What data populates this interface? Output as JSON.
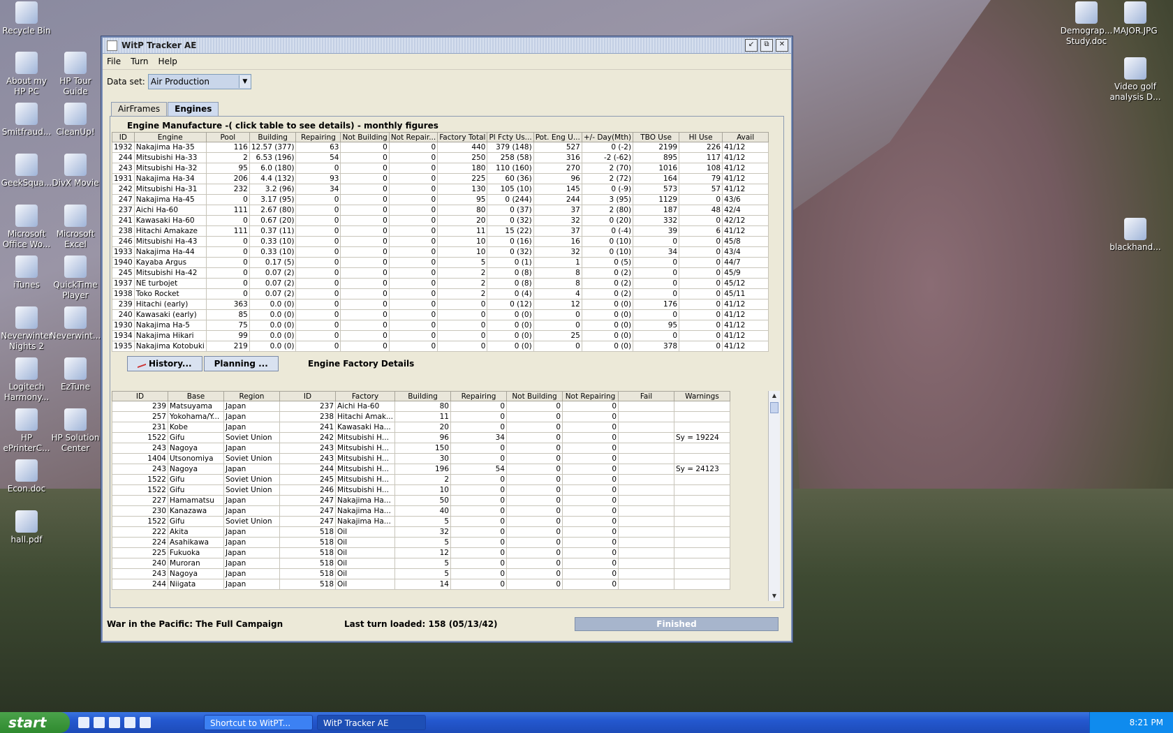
{
  "desktop": {
    "icons_left": [
      {
        "label": "Recycle Bin",
        "icon": "recycle-bin-icon"
      },
      {
        "label": "About my HP PC",
        "icon": "hp-info-icon"
      },
      {
        "label": "HP Tour Guide",
        "icon": "hp-tour-icon"
      },
      {
        "label": "Smitfraud...",
        "icon": "hazard-icon"
      },
      {
        "label": "CleanUp!",
        "icon": "cleanup-icon"
      },
      {
        "label": "GeekSqua...",
        "icon": "ie-icon"
      },
      {
        "label": "DivX Movie",
        "icon": "divx-icon"
      },
      {
        "label": "Microsoft Office Wo...",
        "icon": "word-icon"
      },
      {
        "label": "Microsoft Excel",
        "icon": "excel-icon"
      },
      {
        "label": "iTunes",
        "icon": "itunes-icon"
      },
      {
        "label": "QuickTime Player",
        "icon": "quicktime-icon"
      },
      {
        "label": "Neverwinter Nights 2",
        "icon": "nwn2-icon"
      },
      {
        "label": "Neverwint...",
        "icon": "nwn-icon"
      },
      {
        "label": "Logitech Harmony...",
        "icon": "logitech-icon"
      },
      {
        "label": "EzTune",
        "icon": "eztune-icon"
      },
      {
        "label": "HP ePrinterC...",
        "icon": "hp-printer-icon"
      },
      {
        "label": "HP Solution Center",
        "icon": "hp-solution-icon"
      },
      {
        "label": "Econ.doc",
        "icon": "word-doc-icon"
      },
      {
        "label": "hall.pdf",
        "icon": "pdf-icon"
      }
    ],
    "icons_right": [
      {
        "label": "Demograp... Study.doc",
        "icon": "word-doc-icon"
      },
      {
        "label": "MAJOR.JPG",
        "icon": "image-icon"
      },
      {
        "label": "Video golf analysis D...",
        "icon": "video-icon"
      },
      {
        "label": "blackhand...",
        "icon": "pdf-icon"
      }
    ]
  },
  "window": {
    "title": "WitP Tracker AE",
    "menu": [
      "File",
      "Turn",
      "Help"
    ],
    "dataset_label": "Data set:",
    "dataset_value": "Air Production",
    "tabs": [
      "AirFrames",
      "Engines"
    ],
    "caption": "Engine Manufacture -( click table to see details) - monthly figures",
    "engine_headers": [
      "ID",
      "Engine",
      "Pool",
      "Building",
      "Repairing",
      "Not Building",
      "Not Repair...",
      "Factory Total",
      "Pl Fcty Us...",
      "Pot. Eng U...",
      "+/- Day(Mth)",
      "TBO Use",
      "HI Use",
      "Avail"
    ],
    "engine_rows": [
      [
        "1932",
        "Nakajima Ha-35",
        "116",
        "12.57 (377)",
        "63",
        "0",
        "0",
        "440",
        "379 (148)",
        "527",
        "0 (-2)",
        "2199",
        "226",
        "41/12"
      ],
      [
        "244",
        "Mitsubishi Ha-33",
        "2",
        "6.53 (196)",
        "54",
        "0",
        "0",
        "250",
        "258 (58)",
        "316",
        "-2 (-62)",
        "895",
        "117",
        "41/12"
      ],
      [
        "243",
        "Mitsubishi Ha-32",
        "95",
        "6.0 (180)",
        "0",
        "0",
        "0",
        "180",
        "110 (160)",
        "270",
        "2 (70)",
        "1016",
        "108",
        "41/12"
      ],
      [
        "1931",
        "Nakajima Ha-34",
        "206",
        "4.4 (132)",
        "93",
        "0",
        "0",
        "225",
        "60 (36)",
        "96",
        "2 (72)",
        "164",
        "79",
        "41/12"
      ],
      [
        "242",
        "Mitsubishi Ha-31",
        "232",
        "3.2 (96)",
        "34",
        "0",
        "0",
        "130",
        "105 (10)",
        "145",
        "0 (-9)",
        "573",
        "57",
        "41/12"
      ],
      [
        "247",
        "Nakajima Ha-45",
        "0",
        "3.17 (95)",
        "0",
        "0",
        "0",
        "95",
        "0 (244)",
        "244",
        "3 (95)",
        "1129",
        "0",
        "43/6"
      ],
      [
        "237",
        "Aichi Ha-60",
        "111",
        "2.67 (80)",
        "0",
        "0",
        "0",
        "80",
        "0 (37)",
        "37",
        "2 (80)",
        "187",
        "48",
        "42/4"
      ],
      [
        "241",
        "Kawasaki Ha-60",
        "0",
        "0.67 (20)",
        "0",
        "0",
        "0",
        "20",
        "0 (32)",
        "32",
        "0 (20)",
        "332",
        "0",
        "42/12"
      ],
      [
        "238",
        "Hitachi Amakaze",
        "111",
        "0.37 (11)",
        "0",
        "0",
        "0",
        "11",
        "15 (22)",
        "37",
        "0 (-4)",
        "39",
        "6",
        "41/12"
      ],
      [
        "246",
        "Mitsubishi Ha-43",
        "0",
        "0.33 (10)",
        "0",
        "0",
        "0",
        "10",
        "0 (16)",
        "16",
        "0 (10)",
        "0",
        "0",
        "45/8"
      ],
      [
        "1933",
        "Nakajima Ha-44",
        "0",
        "0.33 (10)",
        "0",
        "0",
        "0",
        "10",
        "0 (32)",
        "32",
        "0 (10)",
        "34",
        "0",
        "43/4"
      ],
      [
        "1940",
        "Kayaba Argus",
        "0",
        "0.17 (5)",
        "0",
        "0",
        "0",
        "5",
        "0 (1)",
        "1",
        "0 (5)",
        "0",
        "0",
        "44/7"
      ],
      [
        "245",
        "Mitsubishi Ha-42",
        "0",
        "0.07 (2)",
        "0",
        "0",
        "0",
        "2",
        "0 (8)",
        "8",
        "0 (2)",
        "0",
        "0",
        "45/9"
      ],
      [
        "1937",
        "NE turbojet",
        "0",
        "0.07 (2)",
        "0",
        "0",
        "0",
        "2",
        "0 (8)",
        "8",
        "0 (2)",
        "0",
        "0",
        "45/12"
      ],
      [
        "1938",
        "Toko Rocket",
        "0",
        "0.07 (2)",
        "0",
        "0",
        "0",
        "2",
        "0 (4)",
        "4",
        "0 (2)",
        "0",
        "0",
        "45/11"
      ],
      [
        "239",
        "Hitachi (early)",
        "363",
        "0.0 (0)",
        "0",
        "0",
        "0",
        "0",
        "0 (12)",
        "12",
        "0 (0)",
        "176",
        "0",
        "41/12"
      ],
      [
        "240",
        "Kawasaki (early)",
        "85",
        "0.0 (0)",
        "0",
        "0",
        "0",
        "0",
        "0 (0)",
        "0",
        "0 (0)",
        "0",
        "0",
        "41/12"
      ],
      [
        "1930",
        "Nakajima Ha-5",
        "75",
        "0.0 (0)",
        "0",
        "0",
        "0",
        "0",
        "0 (0)",
        "0",
        "0 (0)",
        "95",
        "0",
        "41/12"
      ],
      [
        "1934",
        "Nakajima Hikari",
        "99",
        "0.0 (0)",
        "0",
        "0",
        "0",
        "0",
        "0 (0)",
        "25",
        "0 (0)",
        "0",
        "0",
        "41/12"
      ],
      [
        "1935",
        "Nakajima Kotobuki",
        "219",
        "0.0 (0)",
        "0",
        "0",
        "0",
        "0",
        "0 (0)",
        "0",
        "0 (0)",
        "378",
        "0",
        "41/12"
      ]
    ],
    "history_button": "History...",
    "planning_button": "Planning ...",
    "factory_caption": "Engine Factory Details",
    "factory_headers": [
      "ID",
      "Base",
      "Region",
      "ID",
      "Factory",
      "Building",
      "Repairing",
      "Not Building",
      "Not Repairing",
      "Fail",
      "Warnings"
    ],
    "factory_rows": [
      [
        "239",
        "Matsuyama",
        "Japan",
        "237",
        "Aichi Ha-60",
        "80",
        "0",
        "0",
        "0",
        "",
        ""
      ],
      [
        "257",
        "Yokohama/Y...",
        "Japan",
        "238",
        "Hitachi Amak...",
        "11",
        "0",
        "0",
        "0",
        "",
        ""
      ],
      [
        "231",
        "Kobe",
        "Japan",
        "241",
        "Kawasaki Ha...",
        "20",
        "0",
        "0",
        "0",
        "",
        ""
      ],
      [
        "1522",
        "Gifu",
        "Soviet Union",
        "242",
        "Mitsubishi H...",
        "96",
        "34",
        "0",
        "0",
        "",
        "Sy = 19224"
      ],
      [
        "243",
        "Nagoya",
        "Japan",
        "243",
        "Mitsubishi H...",
        "150",
        "0",
        "0",
        "0",
        "",
        ""
      ],
      [
        "1404",
        "Utsonomiya",
        "Soviet Union",
        "243",
        "Mitsubishi H...",
        "30",
        "0",
        "0",
        "0",
        "",
        ""
      ],
      [
        "243",
        "Nagoya",
        "Japan",
        "244",
        "Mitsubishi H...",
        "196",
        "54",
        "0",
        "0",
        "",
        "Sy = 24123"
      ],
      [
        "1522",
        "Gifu",
        "Soviet Union",
        "245",
        "Mitsubishi H...",
        "2",
        "0",
        "0",
        "0",
        "",
        ""
      ],
      [
        "1522",
        "Gifu",
        "Soviet Union",
        "246",
        "Mitsubishi H...",
        "10",
        "0",
        "0",
        "0",
        "",
        ""
      ],
      [
        "227",
        "Hamamatsu",
        "Japan",
        "247",
        "Nakajima Ha...",
        "50",
        "0",
        "0",
        "0",
        "",
        ""
      ],
      [
        "230",
        "Kanazawa",
        "Japan",
        "247",
        "Nakajima Ha...",
        "40",
        "0",
        "0",
        "0",
        "",
        ""
      ],
      [
        "1522",
        "Gifu",
        "Soviet Union",
        "247",
        "Nakajima Ha...",
        "5",
        "0",
        "0",
        "0",
        "",
        ""
      ],
      [
        "222",
        "Akita",
        "Japan",
        "518",
        "Oil",
        "32",
        "0",
        "0",
        "0",
        "",
        ""
      ],
      [
        "224",
        "Asahikawa",
        "Japan",
        "518",
        "Oil",
        "5",
        "0",
        "0",
        "0",
        "",
        ""
      ],
      [
        "225",
        "Fukuoka",
        "Japan",
        "518",
        "Oil",
        "12",
        "0",
        "0",
        "0",
        "",
        ""
      ],
      [
        "240",
        "Muroran",
        "Japan",
        "518",
        "Oil",
        "5",
        "0",
        "0",
        "0",
        "",
        ""
      ],
      [
        "243",
        "Nagoya",
        "Japan",
        "518",
        "Oil",
        "5",
        "0",
        "0",
        "0",
        "",
        ""
      ],
      [
        "244",
        "Niigata",
        "Japan",
        "518",
        "Oil",
        "14",
        "0",
        "0",
        "0",
        "",
        ""
      ]
    ],
    "status_left": "War in the Pacific: The Full Campaign",
    "status_mid": "Last turn loaded: 158 (05/13/42)",
    "status_progress": "Finished",
    "progress_fraction": 1.0
  },
  "taskbar": {
    "start": "start",
    "items": [
      "Shortcut to WitPT...",
      "WitP Tracker AE"
    ],
    "clock": "8:21 PM"
  }
}
